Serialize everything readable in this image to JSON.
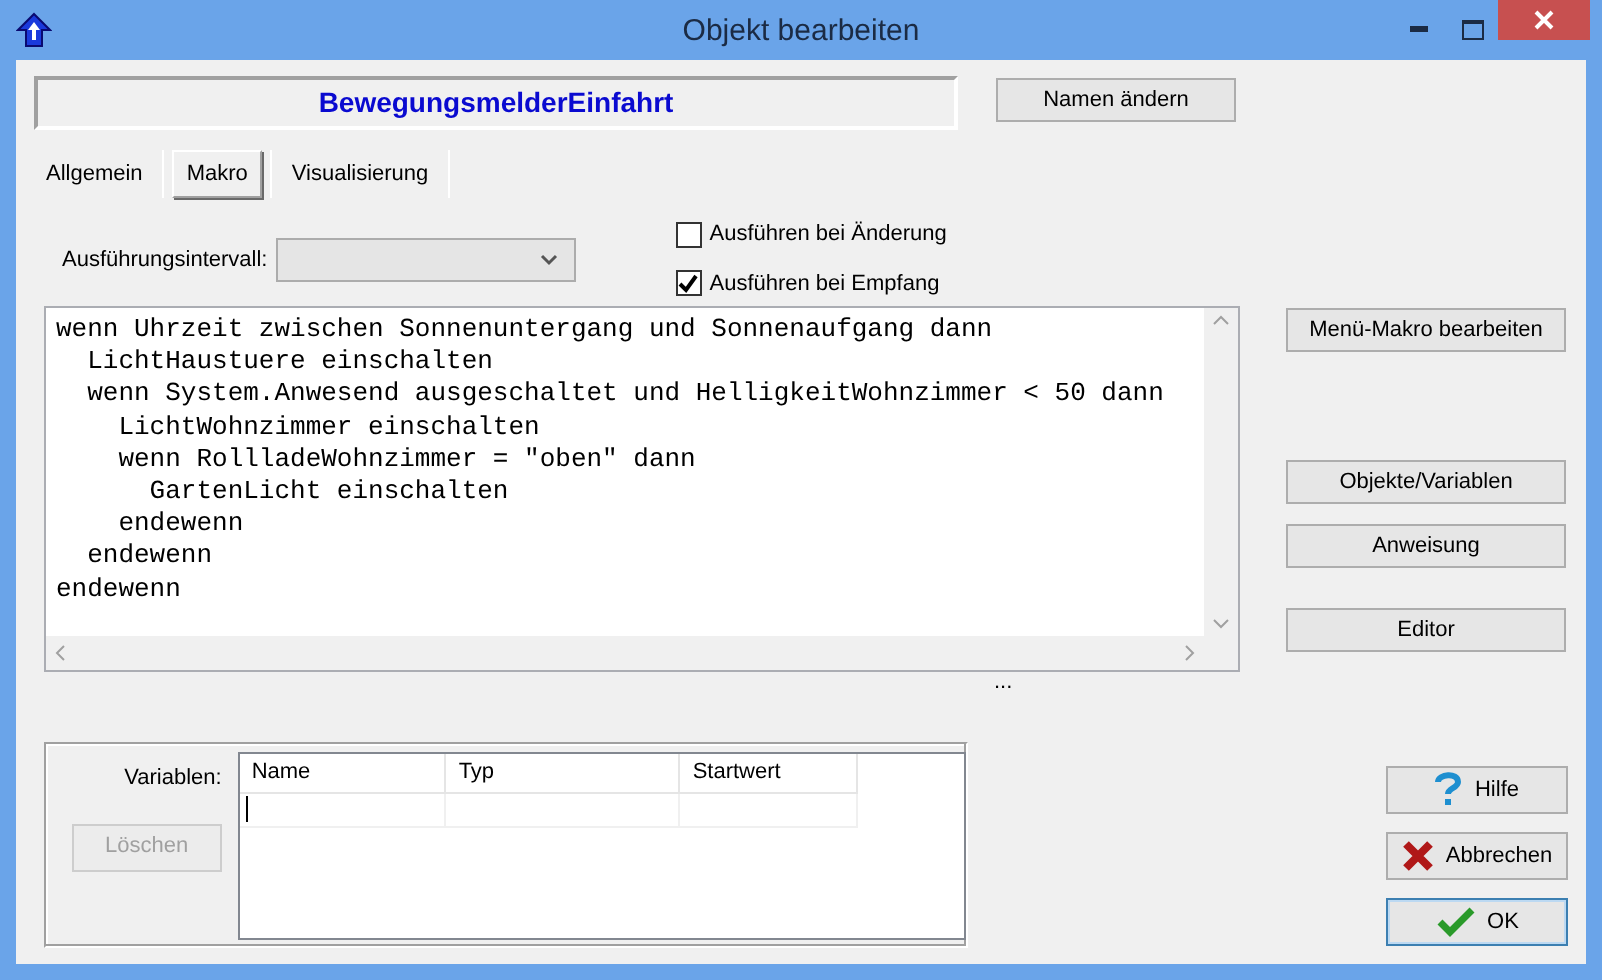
{
  "window": {
    "title": "Objekt bearbeiten"
  },
  "object_name": "BewegungsmelderEinfahrt",
  "rename_button": "Namen ändern",
  "tabs": [
    {
      "label": "Allgemein",
      "selected": false
    },
    {
      "label": "Makro",
      "selected": true
    },
    {
      "label": "Visualisierung",
      "selected": false
    }
  ],
  "interval": {
    "label": "Ausführungsintervall:"
  },
  "options": [
    {
      "label": "Ausführen bei Änderung",
      "checked": false
    },
    {
      "label": "Ausführen bei Empfang",
      "checked": true
    }
  ],
  "macro_lines": [
    "wenn Uhrzeit zwischen Sonnenuntergang und Sonnenaufgang dann",
    "  LichtHaustuere einschalten",
    "  wenn System.Anwesend ausgeschaltet und HelligkeitWohnzimmer < 50 dann",
    "    LichtWohnzimmer einschalten",
    "    wenn RollladeWohnzimmer = \"oben\" dann",
    "      GartenLicht einschalten",
    "    endewenn",
    "  endewenn",
    "endewenn"
  ],
  "more_indicator": "...",
  "side_buttons": [
    "Menü-Makro bearbeiten",
    "Objekte/Variablen",
    "Anweisung",
    "Editor"
  ],
  "variables": {
    "label": "Variablen:",
    "delete_button": {
      "label": "Löschen",
      "disabled": true
    },
    "columns": [
      "Name",
      "Typ",
      "Startwert"
    ]
  },
  "dialog_buttons": [
    {
      "label": "Hilfe",
      "kind": "help"
    },
    {
      "label": "Abbrechen",
      "kind": "cancel"
    },
    {
      "label": "OK",
      "kind": "ok"
    }
  ]
}
